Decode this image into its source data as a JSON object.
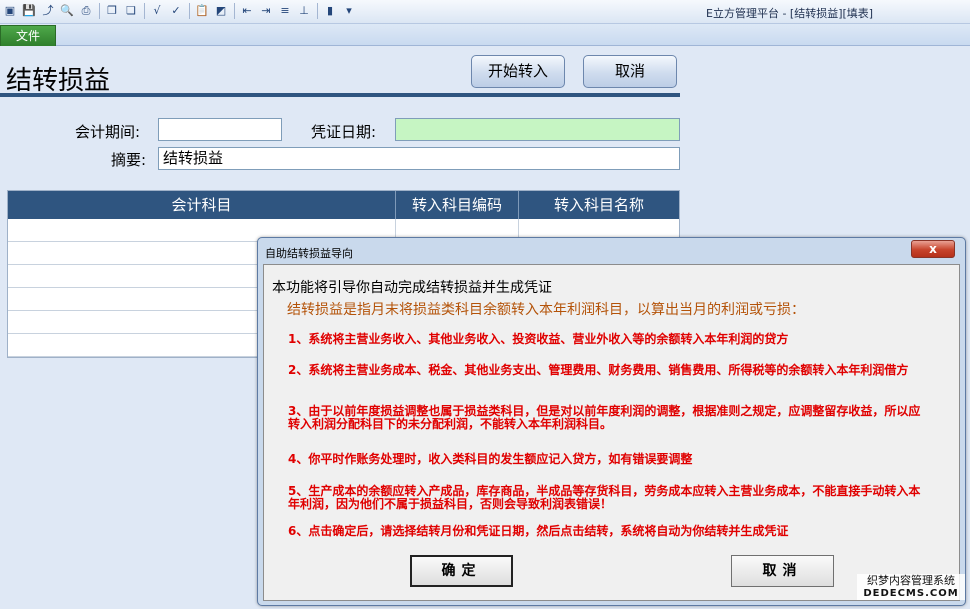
{
  "window": {
    "title": "E立方管理平台 - [结转损益][填表]"
  },
  "ribbon": {
    "file_tab": "文件"
  },
  "toolbar_icons": [
    "window-icon",
    "save-icon",
    "export-icon",
    "preview-icon",
    "print-icon",
    "copy-window-icon",
    "paste-window-icon",
    "formula-icon",
    "formula-check-icon",
    "clipboard-icon",
    "chart-icon",
    "indent-left-icon",
    "indent-right-icon",
    "align-icon",
    "align-bottom-icon",
    "book-icon",
    "dropdown-icon"
  ],
  "form": {
    "page_title": "结转损益",
    "start_button": "开始转入",
    "cancel_button": "取消",
    "period_label": "会计期间:",
    "period_value": "",
    "date_label": "凭证日期:",
    "date_value": "",
    "summary_label": "摘要:",
    "summary_value": "结转损益"
  },
  "grid": {
    "columns": [
      "会计科目",
      "转入科目编码",
      "转入科目名称"
    ],
    "rows": [
      [
        "",
        "",
        ""
      ],
      [
        "",
        "",
        ""
      ],
      [
        "",
        "",
        ""
      ],
      [
        "",
        "",
        ""
      ],
      [
        "",
        "",
        ""
      ],
      [
        "",
        "",
        ""
      ]
    ]
  },
  "dialog": {
    "title": "自助结转损益导向",
    "close_label": "x",
    "heading": "本功能将引导你自动完成结转损益并生成凭证",
    "subheading": "结转损益是指月末将损益类科目余额转入本年利润科目，以算出当月的利润或亏损：",
    "rules": [
      "1、系统将主营业务收入、其他业务收入、投资收益、营业外收入等的余额转入本年利润的贷方",
      "2、系统将主营业务成本、税金、其他业务支出、管理费用、财务费用、销售费用、所得税等的余额转入本年利润借方",
      "3、由于以前年度损益调整也属于损益类科目，但是对以前年度利润的调整，根据准则之规定，应调整留存收益，所以应转入利润分配科目下的未分配利润，不能转入本年利润科目。",
      "4、你平时作账务处理时，收入类科目的发生额应记入贷方，如有错误要调整",
      "5、生产成本的余额应转入产成品，库存商品，半成品等存货科目，劳务成本应转入主营业务成本，不能直接手动转入本年利润，因为他们不属于损益科目，否则会导致利润表错误！",
      "6、点击确定后，请选择结转月份和凭证日期，然后点击结转，系统将自动为你结转并生成凭证"
    ],
    "ok_button": "确定",
    "cancel_button": "取消"
  },
  "watermark": {
    "line1": "织梦内容管理系统",
    "line2": "DEDECMS.COM"
  },
  "colors": {
    "header_blue": "#2f5580",
    "date_field_green": "#c6f5c3",
    "rule_red": "#e00000",
    "subheading_orange": "#b45309"
  }
}
